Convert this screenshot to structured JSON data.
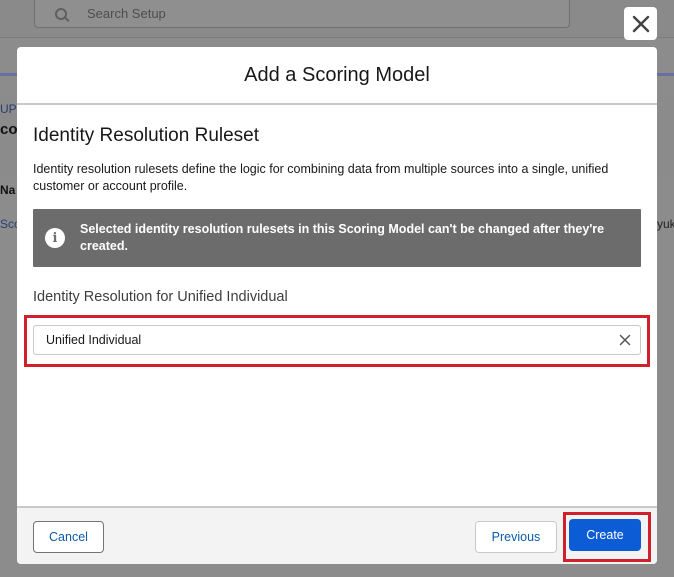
{
  "background": {
    "search_placeholder": "Search Setup",
    "fragments": [
      "UP",
      "co",
      "Na",
      "Sco",
      "yuk"
    ]
  },
  "modal": {
    "title": "Add a Scoring Model",
    "section_title": "Identity Resolution Ruleset",
    "section_description": "Identity resolution rulesets define the logic for combining data from multiple sources into a single, unified customer or account profile.",
    "info_banner_text": "Selected identity resolution rulesets in this Scoring Model can't be changed after they're created.",
    "field_label": "Identity Resolution for Unified Individual",
    "field_value": "Unified Individual"
  },
  "footer": {
    "cancel_label": "Cancel",
    "previous_label": "Previous",
    "create_label": "Create"
  },
  "colors": {
    "primary": "#0b5cd5",
    "link": "#0b5cab",
    "highlight": "#d0202c",
    "banner": "#6c6c6c"
  },
  "icons": {
    "close": "close-icon",
    "search": "search-icon",
    "info": "info-icon",
    "clear": "clear-icon"
  }
}
